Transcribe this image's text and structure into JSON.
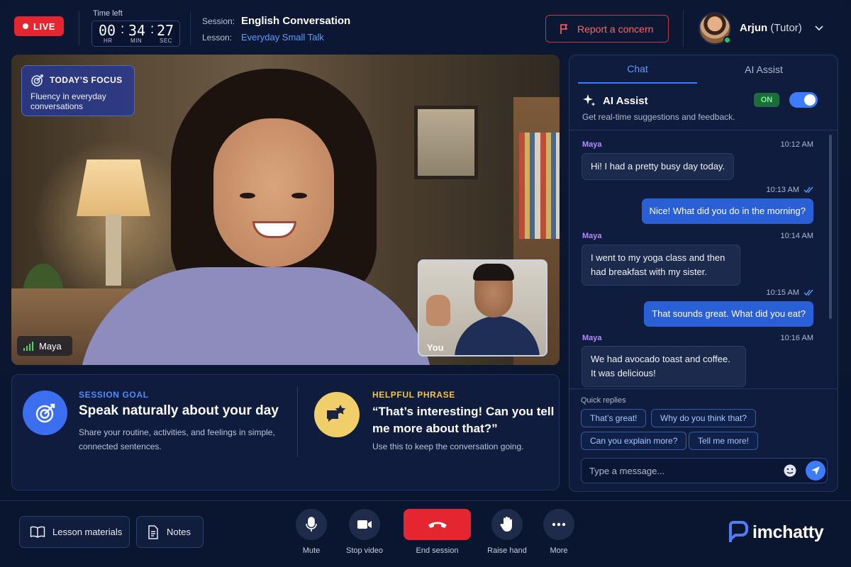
{
  "header": {
    "live_label": "LIVE",
    "timer_label": "Time left",
    "timer": {
      "hr": "00",
      "min": "34",
      "sec": "27",
      "hr_unit": "HR",
      "min_unit": "MIN",
      "sec_unit": "SEC"
    },
    "session_key": "Session:",
    "session_value": "English Conversation",
    "lesson_key": "Lesson:",
    "lesson_value": "Everyday Small Talk",
    "report_label": "Report a concern",
    "tutor_name": "Arjun",
    "tutor_role": "(Tutor)"
  },
  "video": {
    "focus_title": "TODAY’S FOCUS",
    "focus_text": "Fluency in everyday conversations",
    "student_name": "Maya",
    "self_label": "You"
  },
  "goal": {
    "label": "SESSION GOAL",
    "title": "Speak naturally about your day",
    "desc": "Share your routine, activities, and feelings in simple, connected sentences."
  },
  "phrase": {
    "label": "HELPFUL PHRASE",
    "title": "“That’s interesting! Can you tell me more about that?”",
    "desc": "Use this to keep the conversation going."
  },
  "chat": {
    "tabs": [
      {
        "label": "Chat"
      },
      {
        "label": "AI Assist"
      }
    ],
    "ai_title": "AI Assist",
    "ai_sub": "Get real-time suggestions and feedback.",
    "ai_state": "ON",
    "messages": [
      {
        "sender": "Maya",
        "time": "10:12 AM",
        "text": "Hi! I had a pretty busy day today."
      },
      {
        "time": "10:13 AM",
        "text": "Nice! What did you do in the morning?"
      },
      {
        "sender": "Maya",
        "time": "10:14 AM",
        "text": "I went to my yoga class and then had breakfast with my sister."
      },
      {
        "time": "10:15 AM",
        "text": "That sounds great. What did you eat?"
      },
      {
        "sender": "Maya",
        "time": "10:16 AM",
        "text": "We had avocado toast and coffee. It was delicious!"
      }
    ],
    "quick_replies_label": "Quick replies",
    "quick_replies": [
      "That’s great!",
      "Why do you think that?",
      "Can you explain more?",
      "Tell me more!"
    ],
    "input_placeholder": "Type a message..."
  },
  "footer": {
    "lesson_materials": "Lesson materials",
    "notes": "Notes",
    "controls": [
      "Mute",
      "Stop video",
      "End session",
      "Raise hand",
      "More"
    ],
    "brand": "imchatty"
  },
  "colors": {
    "accent": "#3d7bff",
    "live": "#e3262f",
    "goal_accent": "#4f8cff",
    "phrase_accent": "#f3c440"
  },
  "icons": [
    "flag-icon",
    "chevron-down-icon",
    "target-icon",
    "signal-icon",
    "sparkle-icon",
    "double-check-icon",
    "emoji-icon",
    "send-icon",
    "book-icon",
    "notes-icon",
    "mic-icon",
    "video-icon",
    "phone-hangup-icon",
    "hand-icon",
    "more-icon",
    "logo-icon"
  ]
}
